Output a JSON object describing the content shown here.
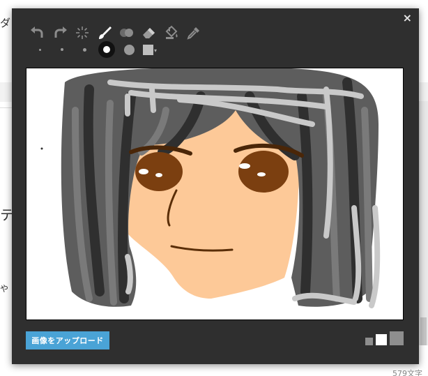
{
  "background": {
    "frag_top": "ダロ",
    "frag_mid": "テ",
    "frag_low": "や",
    "char_count": "579文字"
  },
  "dialog": {
    "close_label": "×",
    "upload_label": "画像をアップロード"
  },
  "toolbar": {
    "tools": [
      {
        "name": "undo-icon"
      },
      {
        "name": "redo-icon"
      },
      {
        "name": "spray-icon"
      },
      {
        "name": "brush-icon",
        "selected": true
      },
      {
        "name": "blend-icon"
      },
      {
        "name": "eraser-icon"
      },
      {
        "name": "fill-bucket-icon"
      },
      {
        "name": "eyedropper-icon"
      }
    ],
    "brush_sizes": [
      "xs",
      "s",
      "m",
      "l",
      "xl"
    ],
    "selected_size": "l",
    "current_color": "#bfbfbf"
  },
  "canvas_sizes": [
    "small",
    "medium",
    "large"
  ],
  "colors": {
    "modal_bg": "#2f2f2f",
    "accent": "#4aa3d6",
    "skin": "#fdc998",
    "eye": "#7b3f10"
  }
}
